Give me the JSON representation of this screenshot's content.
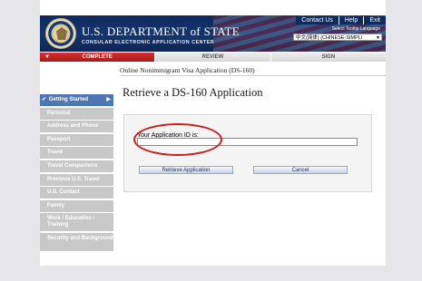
{
  "header": {
    "title": "U.S. DEPARTMENT of STATE",
    "subtitle": "CONSULAR ELECTRONIC APPLICATION CENTER",
    "links": [
      "Contact Us",
      "Help",
      "Exit"
    ],
    "tooltip_language_label": "Select Tooltip Language",
    "language_value": "中文(简体) (CHINESE-SIMPLI"
  },
  "progress": {
    "steps": [
      "COMPLETE",
      "REVIEW",
      "SIGN"
    ],
    "active_index": 0
  },
  "breadcrumb": "Online Nonimmigrant Visa Application (DS-160)",
  "page_title": "Retrieve a DS-160 Application",
  "sidebar": {
    "items": [
      {
        "label": "Getting Started",
        "active": true
      },
      {
        "label": "Personal"
      },
      {
        "label": "Address and Phone"
      },
      {
        "label": "Passport"
      },
      {
        "label": "Travel"
      },
      {
        "label": "Travel Companions"
      },
      {
        "label": "Previous U.S. Travel"
      },
      {
        "label": "U.S. Contact"
      },
      {
        "label": "Family"
      },
      {
        "label": "Work / Education / Training"
      },
      {
        "label": "Security and Background"
      }
    ]
  },
  "form": {
    "application_id_label": "Your Application ID is:",
    "application_id_value": "",
    "retrieve_button": "Retrieve Application",
    "cancel_button": "Cancel"
  },
  "colors": {
    "header_navy": "#0f2a5e",
    "step_active_red": "#c02020",
    "sidebar_active_blue": "#4e76b2",
    "sidebar_gray": "#c8c8c8",
    "highlight_ellipse": "#cc1c1c"
  }
}
